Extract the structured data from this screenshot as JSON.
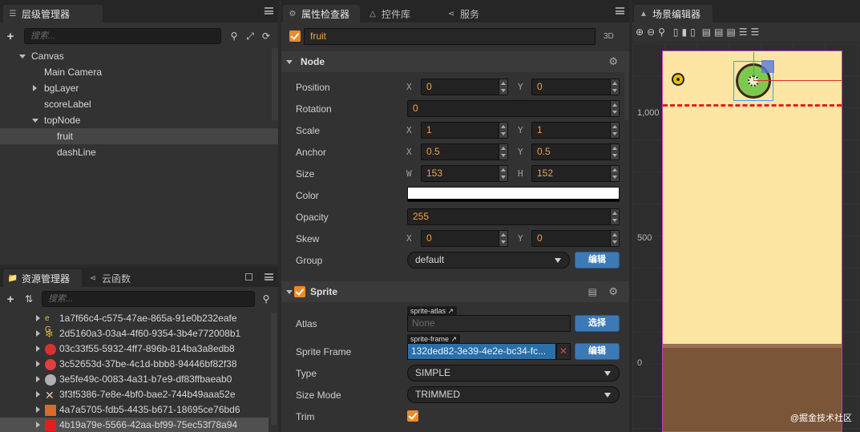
{
  "hierarchy": {
    "title": "层级管理器",
    "search_placeholder": "搜索...",
    "tree": [
      {
        "label": "Canvas",
        "depth": 0,
        "expander": "down"
      },
      {
        "label": "Main Camera",
        "depth": 1,
        "expander": "none"
      },
      {
        "label": "bgLayer",
        "depth": 1,
        "expander": "right"
      },
      {
        "label": "scoreLabel",
        "depth": 1,
        "expander": "none"
      },
      {
        "label": "topNode",
        "depth": 1,
        "expander": "down"
      },
      {
        "label": "fruit",
        "depth": 2,
        "expander": "none",
        "selected": true
      },
      {
        "label": "dashLine",
        "depth": 2,
        "expander": "none"
      }
    ]
  },
  "assets": {
    "tab_assets": "资源管理器",
    "tab_cloud": "云函数",
    "search_placeholder": "搜索...",
    "items": [
      {
        "label": "1a7f66c4-c575-47ae-865a-91e0b232eafe",
        "icon": "text-e-g-icon",
        "color": "#e8c04a"
      },
      {
        "label": "2d5160a3-03a4-4f60-9354-3b4e772008b1",
        "icon": "branch-icon",
        "color": "#c9a640"
      },
      {
        "label": "03c33f55-5932-4ff7-896b-814ba3a8edb8",
        "icon": "splat-icon",
        "color": "#d93030"
      },
      {
        "label": "3c52653d-37be-4c1d-bbb8-94446bf82f38",
        "icon": "number-one-icon",
        "color": "#e04040"
      },
      {
        "label": "3e5fe49c-0083-4a31-b7e9-df83ffbaeab0",
        "icon": "circle-icon",
        "color": "#b0b0b0"
      },
      {
        "label": "3f3f5386-7e8e-4bf0-bae2-744b49aaa52e",
        "icon": "cross-icon",
        "color": "#e0c9a0"
      },
      {
        "label": "4a7a5705-fdb5-4435-b671-18695ce76bd6",
        "icon": "fruit-pile-icon",
        "color": "#d86a2a"
      },
      {
        "label": "4b19a79e-5566-42aa-bf99-75ec53f78a94",
        "icon": "red-square-icon",
        "color": "#e02020",
        "selected": true
      }
    ]
  },
  "inspector": {
    "tab_inspector": "属性检查器",
    "tab_widgets": "控件库",
    "tab_service": "服务",
    "node_name": "fruit",
    "mode_3d": "3D",
    "node_section": "Node",
    "props": {
      "position": {
        "label": "Position",
        "x": "0",
        "y": "0"
      },
      "rotation": {
        "label": "Rotation",
        "value": "0"
      },
      "scale": {
        "label": "Scale",
        "x": "1",
        "y": "1"
      },
      "anchor": {
        "label": "Anchor",
        "x": "0.5",
        "y": "0.5"
      },
      "size": {
        "label": "Size",
        "w": "153",
        "h": "152"
      },
      "color": {
        "label": "Color",
        "value": "#ffffff"
      },
      "opacity": {
        "label": "Opacity",
        "value": "255"
      },
      "skew": {
        "label": "Skew",
        "x": "0",
        "y": "0"
      },
      "group": {
        "label": "Group",
        "value": "default",
        "edit": "编辑"
      }
    },
    "axis_x": "X",
    "axis_y": "Y",
    "axis_w": "W",
    "axis_h": "H",
    "sprite_section": "Sprite",
    "sprite": {
      "atlas_label": "Atlas",
      "atlas_tag": "sprite-atlas",
      "atlas_value": "None",
      "atlas_button": "选择",
      "frame_label": "Sprite Frame",
      "frame_tag": "sprite-frame",
      "frame_value": "132ded82-3e39-4e2e-bc34-fc...",
      "frame_button": "编辑",
      "type_label": "Type",
      "type_value": "SIMPLE",
      "sizemode_label": "Size Mode",
      "sizemode_value": "TRIMMED",
      "trim_label": "Trim"
    }
  },
  "scene": {
    "title": "场景编辑器",
    "ruler_labels": [
      "1,000",
      "500",
      "0"
    ],
    "bg_color": "#fde5a3",
    "ground_color": "#7a5538",
    "dash_color": "#e02020"
  },
  "watermark": "@掘金技术社区"
}
